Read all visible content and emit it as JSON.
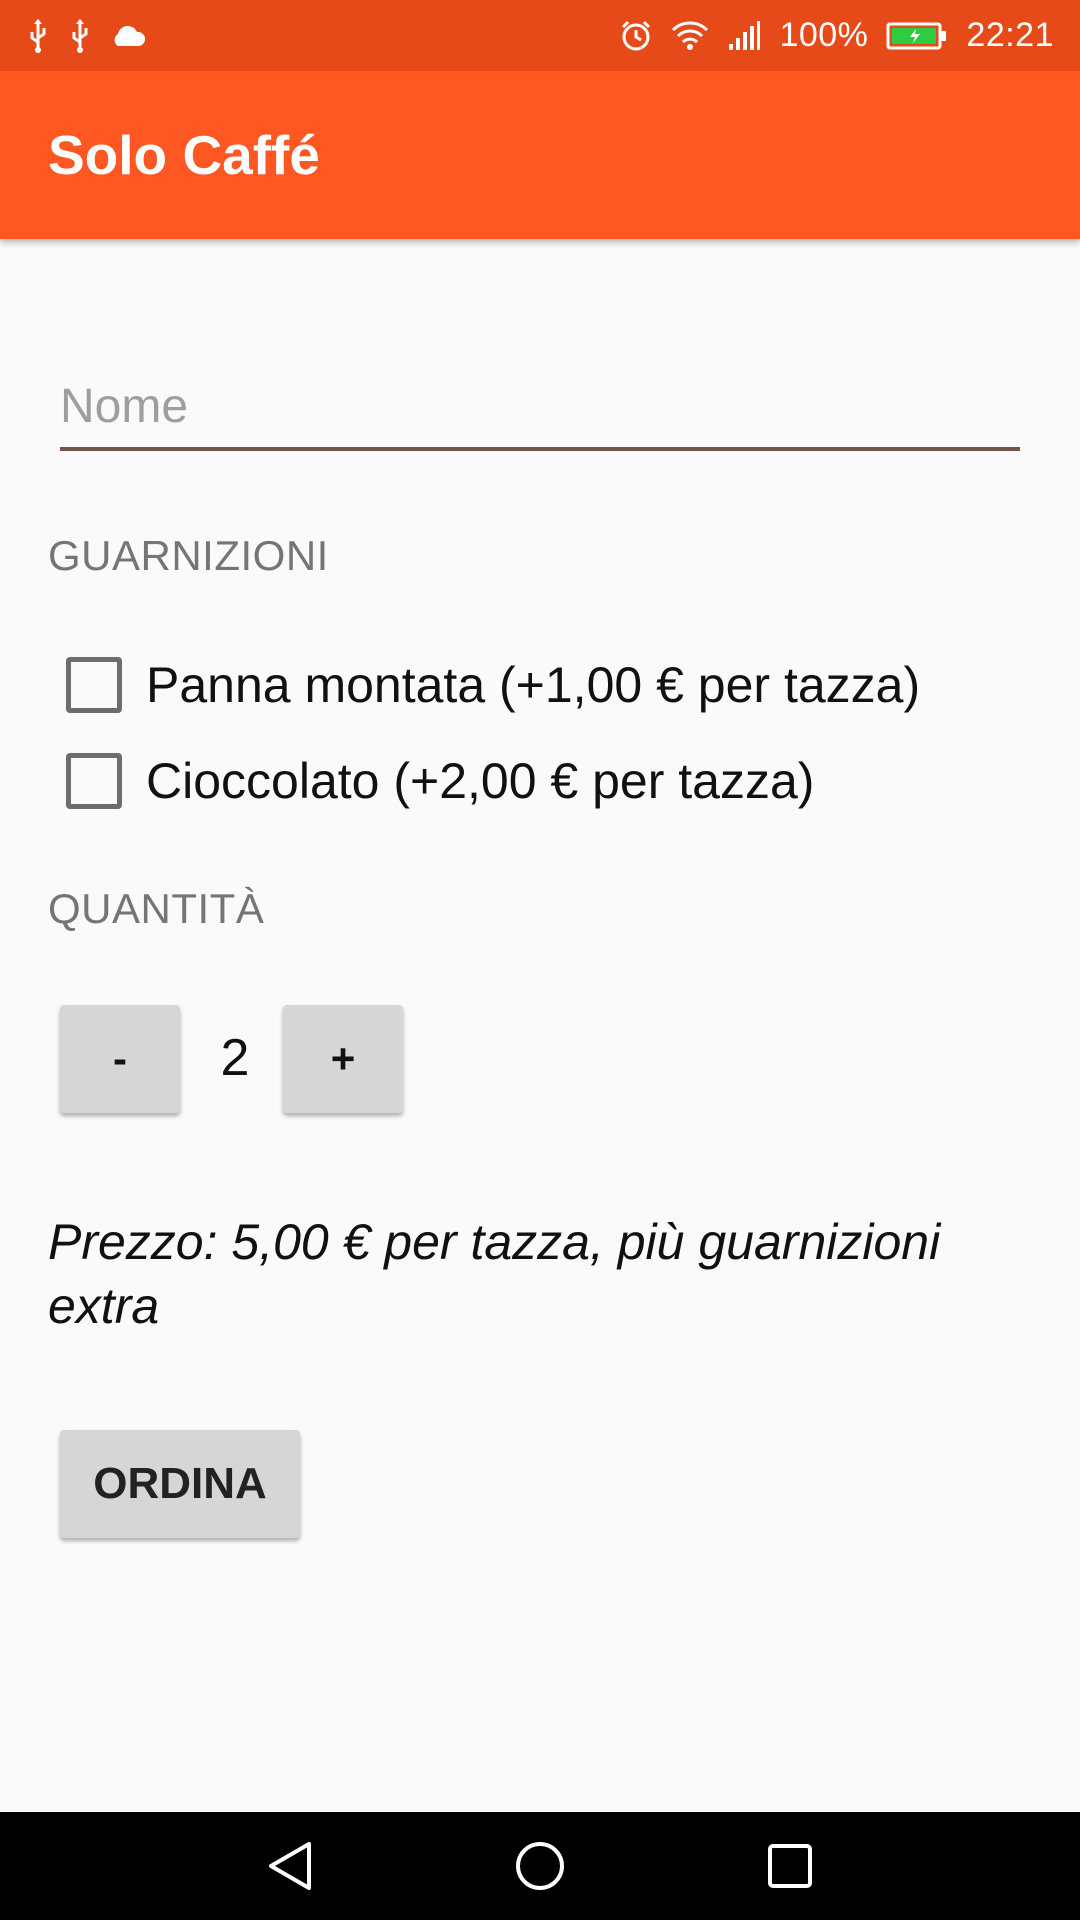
{
  "status_bar": {
    "left_icons": [
      "usb-icon",
      "usb-icon",
      "cloud-icon"
    ],
    "right_icons": [
      "alarm-icon",
      "wifi-icon",
      "signal-icon",
      "battery-charging-icon"
    ],
    "battery": "100%",
    "time": "22:21"
  },
  "app_bar": {
    "title": "Solo Caffé",
    "color": "#ff5722",
    "status_color": "#e64a19"
  },
  "form": {
    "name_placeholder": "Nome",
    "name_value": "",
    "toppings_label": "GUARNIZIONI",
    "toppings": [
      {
        "label": "Panna montata (+1,00 € per tazza)",
        "checked": false
      },
      {
        "label": "Cioccolato (+2,00 € per tazza)",
        "checked": false
      }
    ],
    "quantity_label": "QUANTITÀ",
    "decrement_label": "-",
    "quantity": "2",
    "increment_label": "+",
    "price_text": "Prezzo: 5,00 € per tazza, più guarnizioni extra",
    "order_label": "ORDINA"
  },
  "nav_bar": {
    "buttons": [
      "back-icon",
      "home-icon",
      "recents-icon"
    ]
  }
}
